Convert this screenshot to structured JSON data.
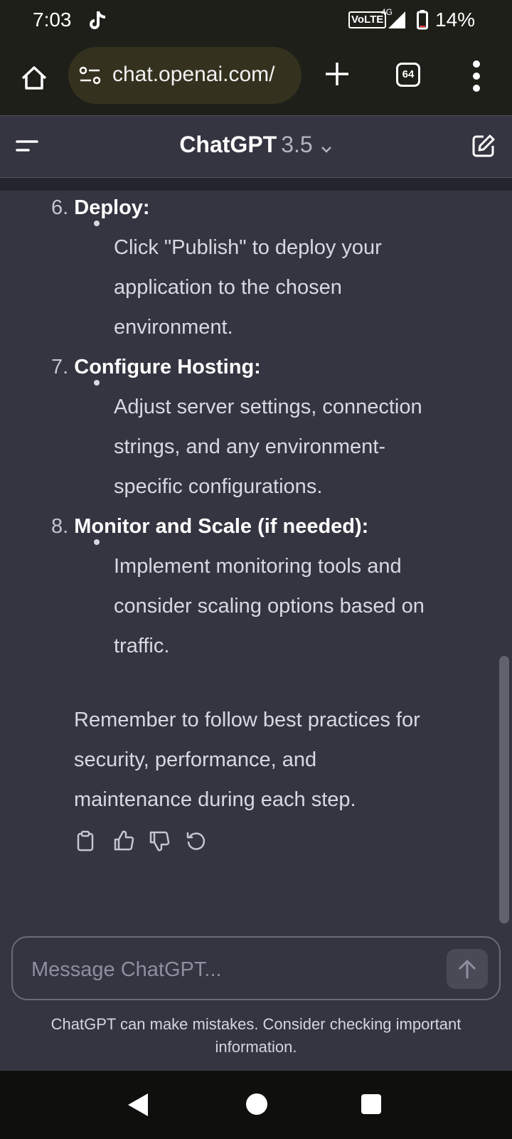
{
  "status_bar": {
    "time": "7:03",
    "network_label": "VoLTE",
    "network_type": "4G",
    "battery": "14%",
    "icons": [
      "tiktok-icon",
      "signal-icon",
      "battery-icon"
    ]
  },
  "browser": {
    "url": "chat.openai.com/",
    "tab_count": "64",
    "icons": [
      "home-icon",
      "site-settings-icon",
      "plus-icon",
      "more-vert-icon"
    ]
  },
  "header": {
    "title": "ChatGPT",
    "version": "3.5",
    "icons": [
      "menu-icon",
      "chevron-down-icon",
      "new-chat-icon"
    ]
  },
  "content": {
    "steps": [
      {
        "num": "6.",
        "heading": "Deploy:",
        "bullet_lines": [
          "Click \"Publish\" to deploy your",
          "application to the chosen",
          "environment."
        ]
      },
      {
        "num": "7.",
        "heading": "Configure Hosting:",
        "bullet_lines": [
          "Adjust server settings, connection",
          "strings, and any environment-",
          "specific configurations."
        ]
      },
      {
        "num": "8.",
        "heading": "Monitor and Scale (if needed):",
        "bullet_lines": [
          "Implement monitoring tools and",
          "consider scaling options based on",
          "traffic."
        ]
      }
    ],
    "closing_lines": [
      "Remember to follow best practices for",
      "security, performance, and",
      "maintenance during each step."
    ],
    "action_icons": [
      "copy-icon",
      "thumbs-up-icon",
      "thumbs-down-icon",
      "regenerate-icon"
    ]
  },
  "composer": {
    "placeholder": "Message ChatGPT...",
    "disclaimer": "ChatGPT can make mistakes. Consider checking important information."
  },
  "colors": {
    "background": "#343541",
    "toolbar": "#1f1f19",
    "url_pill": "#34321f"
  }
}
